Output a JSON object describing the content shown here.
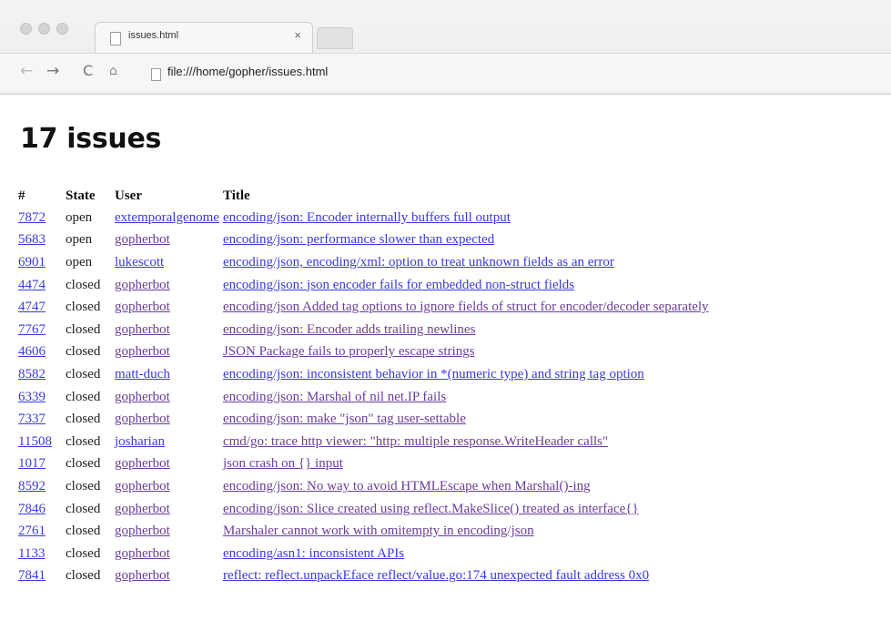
{
  "browser": {
    "tab_title": "issues.html",
    "tab_close": "×",
    "url": "file:///home/gopher/issues.html",
    "icons": [
      "back-arrow-icon",
      "forward-arrow-icon",
      "reload-icon",
      "home-icon",
      "page-icon"
    ]
  },
  "page": {
    "heading": "17 issues",
    "columns": [
      "#",
      "State",
      "User",
      "Title"
    ],
    "rows": [
      {
        "num": "7872",
        "state": "open",
        "user": "extemporalgenome",
        "title": "encoding/json: Encoder internally buffers full output"
      },
      {
        "num": "5683",
        "state": "open",
        "user": "gopherbot",
        "title": "encoding/json: performance slower than expected"
      },
      {
        "num": "6901",
        "state": "open",
        "user": "lukescott",
        "title": "encoding/json, encoding/xml: option to treat unknown fields as an error"
      },
      {
        "num": "4474",
        "state": "closed",
        "user": "gopherbot",
        "title": "encoding/json: json encoder fails for embedded non-struct fields"
      },
      {
        "num": "4747",
        "state": "closed",
        "user": "gopherbot",
        "title": "encoding/json Added tag options to ignore fields of struct for encoder/decoder separately"
      },
      {
        "num": "7767",
        "state": "closed",
        "user": "gopherbot",
        "title": "encoding/json: Encoder adds trailing newlines"
      },
      {
        "num": "4606",
        "state": "closed",
        "user": "gopherbot",
        "title": "JSON Package fails to properly escape strings"
      },
      {
        "num": "8582",
        "state": "closed",
        "user": "matt-duch",
        "title": "encoding/json: inconsistent behavior in *(numeric type) and string tag option"
      },
      {
        "num": "6339",
        "state": "closed",
        "user": "gopherbot",
        "title": "encoding/json: Marshal of nil net.IP fails"
      },
      {
        "num": "7337",
        "state": "closed",
        "user": "gopherbot",
        "title": "encoding/json: make \"json\" tag user-settable"
      },
      {
        "num": "11508",
        "state": "closed",
        "user": "josharian",
        "title": "cmd/go: trace http viewer: \"http: multiple response.WriteHeader calls\""
      },
      {
        "num": "1017",
        "state": "closed",
        "user": "gopherbot",
        "title": "json crash on {} input"
      },
      {
        "num": "8592",
        "state": "closed",
        "user": "gopherbot",
        "title": "encoding/json: No way to avoid HTMLEscape when Marshal()-ing"
      },
      {
        "num": "7846",
        "state": "closed",
        "user": "gopherbot",
        "title": "encoding/json: Slice created using reflect.MakeSlice() treated as interface{}"
      },
      {
        "num": "2761",
        "state": "closed",
        "user": "gopherbot",
        "title": "Marshaler cannot work with omitempty in encoding/json"
      },
      {
        "num": "1133",
        "state": "closed",
        "user": "gopherbot",
        "title": "encoding/asn1: inconsistent APIs"
      },
      {
        "num": "7841",
        "state": "closed",
        "user": "gopherbot",
        "title": "reflect: reflect.unpackEface reflect/value.go:174 unexpected fault address 0x0"
      }
    ]
  },
  "colors": {
    "link": "#3a3ae0",
    "visited_link": "#6a3d9a"
  }
}
